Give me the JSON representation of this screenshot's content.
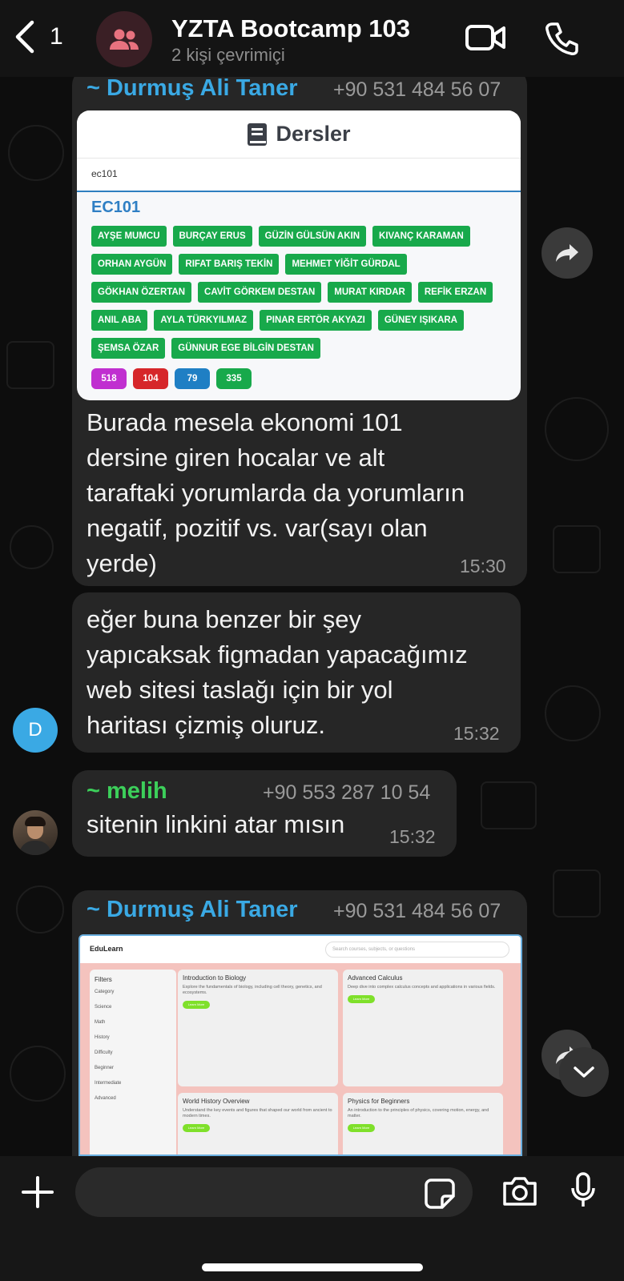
{
  "header": {
    "back_count": "1",
    "title": "YZTA Bootcamp 103",
    "subtitle": "2 kişi çevrimiçi",
    "icons": [
      "chevron-left-icon",
      "group-icon",
      "video-call-icon",
      "phone-icon"
    ]
  },
  "messages": [
    {
      "sender": "~ Durmuş Ali Taner",
      "sender_color": "#3aa9e4",
      "phone": "+90 531 484 56 07",
      "image": {
        "title": "Dersler",
        "search_value": "ec101",
        "course_code": "EC101",
        "teachers": [
          "AYŞE MUMCU",
          "BURÇAY ERUS",
          "GÜZİN GÜLSÜN AKIN",
          "KIVANÇ KARAMAN",
          "ORHAN AYGÜN",
          "RIFAT BARIŞ TEKİN",
          "MEHMET YİĞİT GÜRDAL",
          "GÖKHAN ÖZERTAN",
          "CAVİT GÖRKEM DESTAN",
          "MURAT KIRDAR",
          "REFİK ERZAN",
          "ANIL ABA",
          "AYLA TÜRKYILMAZ",
          "PINAR ERTÖR AKYAZI",
          "GÜNEY IŞIKARA",
          "ŞEMSA ÖZAR",
          "GÜNNUR EGE BİLGİN DESTAN"
        ],
        "counts": [
          {
            "value": "518",
            "color": "#c02fd0"
          },
          {
            "value": "104",
            "color": "#d6262a"
          },
          {
            "value": "79",
            "color": "#1f7fc4"
          },
          {
            "value": "335",
            "color": "#18a94b"
          }
        ]
      },
      "lines": [
        "Burada mesela ekonomi 101",
        "dersine giren hocalar ve alt",
        "taraftaki yorumlarda da yorumların",
        "negatif, pozitif vs. var(sayı olan",
        "yerde)"
      ],
      "time": "15:30"
    },
    {
      "lines": [
        "eğer buna benzer bir şey",
        "yapıcaksak figmadan yapacağımız",
        "web sitesi taslağı için bir yol",
        "haritası çizmiş oluruz."
      ],
      "time": "15:32",
      "avatar_letter": "D"
    },
    {
      "sender": "~ melih",
      "sender_color": "#3ccf5a",
      "phone": "+90 553 287 10 54",
      "lines": [
        "sitenin linkini atar mısın"
      ],
      "time": "15:32"
    },
    {
      "sender": "~ Durmuş Ali Taner",
      "sender_color": "#3aa9e4",
      "phone": "+90 531 484 56 07",
      "image": {
        "brand": "EduLearn",
        "search_placeholder": "Search courses, subjects, or questions",
        "filters": [
          "Filters",
          "Category",
          "Science",
          "Math",
          "History",
          "Difficulty",
          "Beginner",
          "Intermediate",
          "Advanced"
        ],
        "cards": [
          {
            "title": "Introduction to Biology",
            "desc": "Explore the fundamentals of biology, including cell theory, genetics, and ecosystems.",
            "button": "Learn More"
          },
          {
            "title": "Advanced Calculus",
            "desc": "Deep dive into complex calculus concepts and applications in various fields.",
            "button": "Learn More"
          },
          {
            "title": "World History Overview",
            "desc": "Understand the key events and figures that shaped our world from ancient to modern times.",
            "button": "Learn More"
          },
          {
            "title": "Physics for Beginners",
            "desc": "An introduction to the principles of physics, covering motion, energy, and matter.",
            "button": "Learn More"
          }
        ]
      }
    }
  ],
  "input": {
    "icons": [
      "plus-icon",
      "sticker-icon",
      "camera-icon",
      "microphone-icon"
    ]
  }
}
